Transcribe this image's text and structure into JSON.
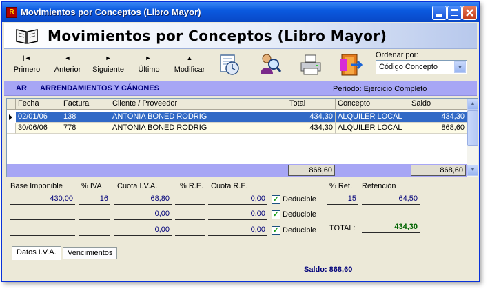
{
  "window": {
    "title": "Movimientos por Conceptos (Libro Mayor)",
    "app_icon_text": "R"
  },
  "header": {
    "title": "Movimientos por Conceptos (Libro Mayor)"
  },
  "toolbar": {
    "primero": "Primero",
    "anterior": "Anterior",
    "siguiente": "Siguiente",
    "ultimo": "Último",
    "modificar": "Modificar",
    "order_label": "Ordenar por:",
    "order_value": "Código Concepto"
  },
  "concept": {
    "code": "AR",
    "name": "ARRENDAMIENTOS Y CÁNONES",
    "period": "Período: Ejercicio Completo"
  },
  "grid": {
    "columns": [
      "Fecha",
      "Factura",
      "Cliente / Proveedor",
      "Total",
      "Concepto",
      "Saldo"
    ],
    "rows": [
      {
        "fecha": "02/01/06",
        "factura": "138",
        "cliente": "ANTONIA BONED RODRIG",
        "total": "434,30",
        "concepto": "ALQUILER LOCAL",
        "saldo": "434,30"
      },
      {
        "fecha": "30/06/06",
        "factura": "778",
        "cliente": "ANTONIA BONED RODRIG",
        "total": "434,30",
        "concepto": "ALQUILER LOCAL",
        "saldo": "868,60"
      }
    ],
    "footer_total": "868,60",
    "footer_saldo": "868,60"
  },
  "iva": {
    "labels": {
      "base": "Base Imponible",
      "piva": "% IVA",
      "cuota_iva": "Cuota I.V.A.",
      "pre": "% R.E.",
      "cuota_re": "Cuota R.E.",
      "pret": "% Ret.",
      "retencion": "Retención",
      "total": "TOTAL:"
    },
    "deducible_label": "Deducible",
    "row1": {
      "base": "430,00",
      "piva": "16",
      "cuota_iva": "68,80",
      "cuota_re": "0,00"
    },
    "row2": {
      "cuota_iva": "0,00",
      "cuota_re": "0,00"
    },
    "row3": {
      "cuota_iva": "0,00",
      "cuota_re": "0,00"
    },
    "pret": "15",
    "retencion": "64,50",
    "total": "434,30"
  },
  "tabs": [
    "Datos I.V.A.",
    "Vencimientos"
  ],
  "status": {
    "saldo": "Saldo: 868,60"
  }
}
